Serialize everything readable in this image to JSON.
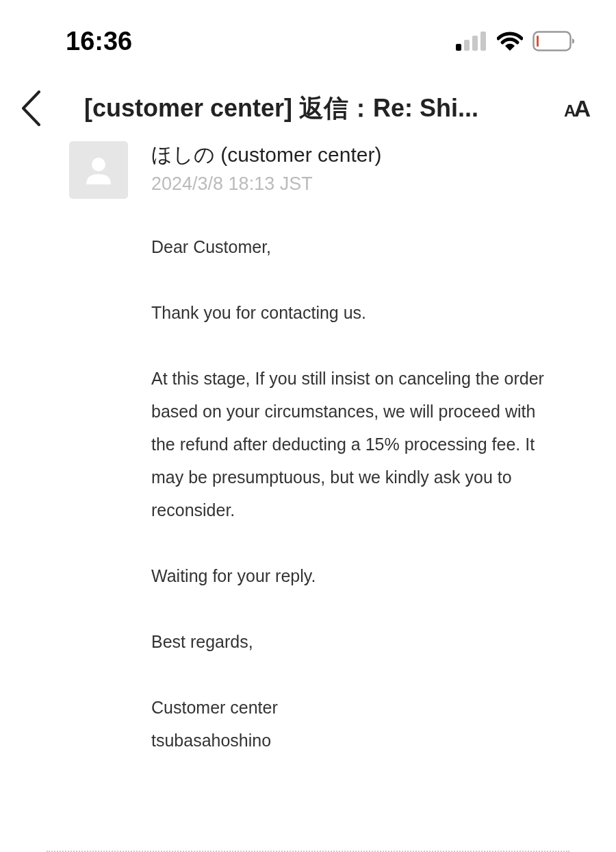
{
  "status_bar": {
    "time": "16:36"
  },
  "header": {
    "title": "[customer center] 返信：Re: Shi...",
    "text_size_button": "AA"
  },
  "message": {
    "sender": "ほしの (customer center)",
    "date": "2024/3/8 18:13 JST",
    "body": [
      [
        "Dear Customer,"
      ],
      [
        "Thank you for contacting us."
      ],
      [
        "At this stage, If you still insist on canceling the order based on your circumstances, we will proceed with the refund after deducting a 15% processing fee. It may be presumptuous, but we kindly ask you to reconsider."
      ],
      [
        "Waiting for your reply."
      ],
      [
        "Best regards,"
      ],
      [
        "Customer center",
        "tsubasahoshino"
      ]
    ]
  }
}
